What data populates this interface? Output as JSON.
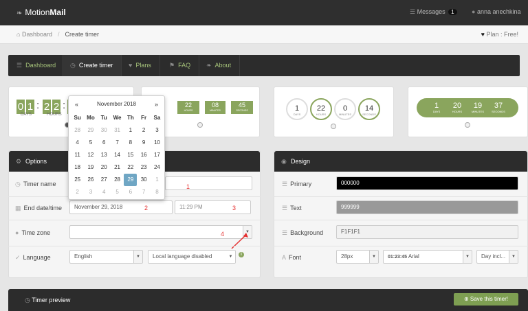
{
  "app": {
    "logo_light": "Motion",
    "logo_bold": "Mail"
  },
  "topbar": {
    "messages_label": "Messages",
    "messages_count": "1",
    "user_name": "anna anechkina"
  },
  "breadcrumb": {
    "home": "Dashboard",
    "current": "Create timer",
    "plan": "Plan : Free!"
  },
  "nav": [
    {
      "label": "Dashboard",
      "icon": "dashboard-icon"
    },
    {
      "label": "Create timer",
      "icon": "clock-icon"
    },
    {
      "label": "Plans",
      "icon": "heart-icon"
    },
    {
      "label": "FAQ",
      "icon": "flag-icon"
    },
    {
      "label": "About",
      "icon": "leaf-icon"
    }
  ],
  "templates": {
    "digits": {
      "d": [
        "0",
        "1"
      ],
      "h": [
        "2",
        "2"
      ],
      "m": [
        "2"
      ],
      "days_label": "DAYS",
      "hours_label": "HOURS"
    },
    "boxes": [
      {
        "n": "22",
        "l": "HOURS"
      },
      {
        "n": "08",
        "l": "MINUTES"
      },
      {
        "n": "45",
        "l": "SECONDS"
      }
    ],
    "circles": [
      {
        "n": "1",
        "l": "DAYS"
      },
      {
        "n": "22",
        "l": "HOURS"
      },
      {
        "n": "0",
        "l": "MINUTES"
      },
      {
        "n": "14",
        "l": "SECONDS"
      }
    ],
    "pill": [
      {
        "n": "1",
        "l": "DAYS"
      },
      {
        "n": "20",
        "l": "HOURS"
      },
      {
        "n": "19",
        "l": "MINUTES"
      },
      {
        "n": "37",
        "l": "SECONDS"
      }
    ]
  },
  "calendar": {
    "month": "November 2018",
    "prev": "«",
    "next": "»",
    "dow": [
      "Su",
      "Mo",
      "Tu",
      "We",
      "Th",
      "Fr",
      "Sa"
    ],
    "days": [
      [
        "28",
        "29",
        "30",
        "31",
        "1",
        "2",
        "3"
      ],
      [
        "4",
        "5",
        "6",
        "7",
        "8",
        "9",
        "10"
      ],
      [
        "11",
        "12",
        "13",
        "14",
        "15",
        "16",
        "17"
      ],
      [
        "18",
        "19",
        "20",
        "21",
        "22",
        "23",
        "24"
      ],
      [
        "25",
        "26",
        "27",
        "28",
        "29",
        "30",
        "1"
      ],
      [
        "2",
        "3",
        "4",
        "5",
        "6",
        "7",
        "8"
      ]
    ],
    "selected": "29"
  },
  "options": {
    "title": "Options",
    "timer_name_label": "Timer name",
    "end_label": "End date/time",
    "end_date": "November 29, 2018",
    "end_time": "11:29 PM",
    "timezone_label": "Time zone",
    "timezone_value": "",
    "language_label": "Language",
    "language_value": "English",
    "local_language": "Local language disabled"
  },
  "annotations": [
    "1",
    "2",
    "3",
    "4"
  ],
  "design": {
    "title": "Design",
    "primary_label": "Primary",
    "primary_value": "000000",
    "primary_color": "#000000",
    "text_label": "Text",
    "text_value": "999999",
    "text_color": "#999999",
    "background_label": "Background",
    "background_value": "F1F1F1",
    "font_label": "Font",
    "font_size": "28px",
    "font_sample": "01:23:45",
    "font_name": "Arial",
    "day_option": "Day incl..."
  },
  "preview": {
    "title": "Timer preview",
    "save_label": "Save this timer!"
  },
  "colors": {
    "accent": "#8aa55d",
    "dark": "#2c2c2c",
    "selected_day": "#6fa6c4"
  }
}
